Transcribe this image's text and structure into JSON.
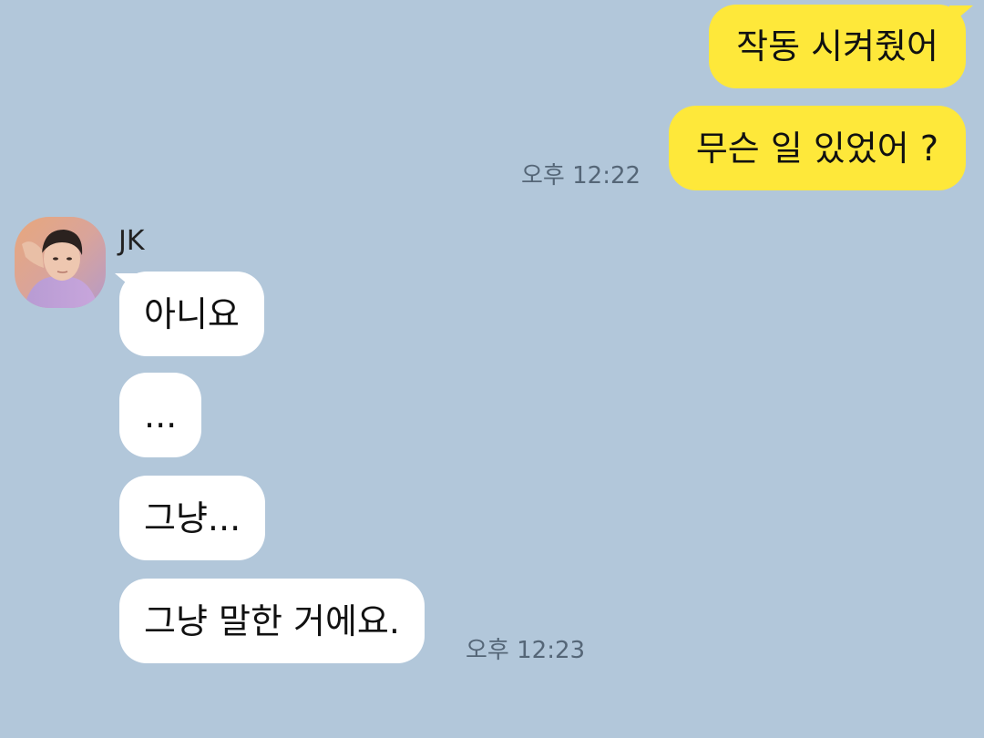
{
  "chat": {
    "outgoing": [
      {
        "text": "작동 시켜줬어"
      },
      {
        "text": "무슨 일 있었어 ?"
      }
    ],
    "outgoing_time": "오후 12:22",
    "sender": {
      "name": "JK",
      "avatar_icon": "profile-photo-icon"
    },
    "incoming": [
      {
        "text": "아니요"
      },
      {
        "text": "..."
      },
      {
        "text": "그냥..."
      },
      {
        "text": "그냥 말한 거에요."
      }
    ],
    "incoming_time": "오후 12:23"
  },
  "colors": {
    "background": "#b2c7da",
    "outgoing_bubble": "#fee83a",
    "incoming_bubble": "#ffffff",
    "timestamp": "#556677"
  }
}
